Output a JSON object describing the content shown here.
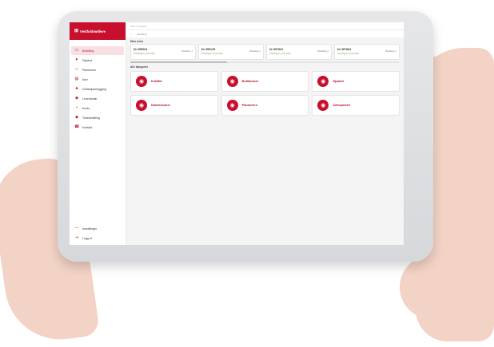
{
  "brand": {
    "title": "Vestfoldmølleve",
    "logo_icon": "grid-logo-icon",
    "accent": "#c8102e"
  },
  "topbar": {
    "placeholder": "Søk i katalogen"
  },
  "breadcrumb": {
    "home_icon": "home-icon",
    "current": "Bestilling"
  },
  "sidebar": {
    "items": [
      {
        "label": "Bestilling",
        "icon": "cart-icon",
        "active": true
      },
      {
        "label": "Fjøsbot",
        "icon": "cow-icon"
      },
      {
        "label": "Plantevern",
        "icon": "leaf-icon"
      },
      {
        "label": "Kart",
        "icon": "map-icon"
      },
      {
        "label": "Gödselplanlegging",
        "icon": "sprout-icon"
      },
      {
        "label": "Leverandør",
        "icon": "truck-icon"
      },
      {
        "label": "Konto",
        "icon": "user-icon"
      },
      {
        "label": "Timebestilling",
        "icon": "clock-icon"
      },
      {
        "label": "Kontakt",
        "icon": "phone-icon"
      }
    ],
    "bottom": [
      {
        "label": "Innstillinger",
        "icon": "gear-icon"
      },
      {
        "label": "Logg ut",
        "icon": "logout-icon"
      }
    ]
  },
  "orders": {
    "title": "Mine ordre",
    "items": [
      {
        "number": "Nr 359924",
        "status": "Ordrelagert 24.05.2020",
        "label": "Bestilling 1"
      },
      {
        "number": "Nr 359145",
        "status": "Ordrelagert 23.07.2020",
        "label": "Bestilling 2"
      },
      {
        "number": "Nr 357822",
        "status": "Ordrelagert 23.07.2020",
        "label": "Bestilling 4"
      },
      {
        "number": "Nr 357864",
        "status": "Ordrelagert 23.07.2020",
        "label": "Bestilling 1"
      }
    ]
  },
  "categories": {
    "title": "Alle kategorier",
    "items": [
      {
        "name": "Kraftfôr",
        "icon": "feed-icon"
      },
      {
        "name": "Butikkvarer",
        "icon": "shop-icon"
      },
      {
        "name": "Gjødsel",
        "icon": "fertilizer-icon"
      },
      {
        "name": "Handelsvarer",
        "icon": "crate-icon"
      },
      {
        "name": "Plantevern",
        "icon": "leaf-icon"
      },
      {
        "name": "Settepoteter",
        "icon": "potato-icon"
      }
    ]
  }
}
